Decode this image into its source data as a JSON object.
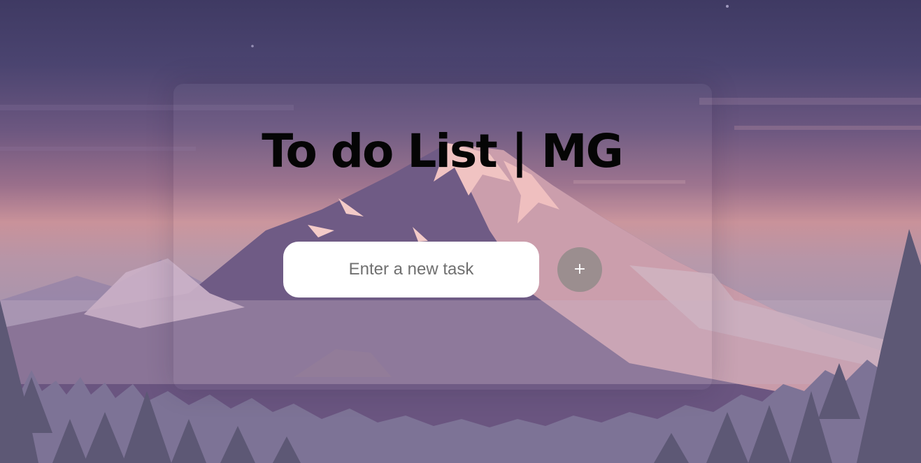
{
  "app": {
    "title": "To do List | MG"
  },
  "task_form": {
    "input_value": "",
    "input_placeholder": "Enter a new task",
    "add_button_label": "+"
  },
  "background": {
    "image": "mountain-landscape",
    "colors": {
      "sky_top": "#3f3a63",
      "sky_glow": "#c9929a",
      "mountain": "#5c4c72",
      "snow": "#e9b8b8",
      "trees": "#5b5672"
    }
  },
  "colors": {
    "title": "#050505",
    "input_bg": "#ffffff",
    "add_button_bg": "#9b8e8f",
    "add_button_fg": "#ffffff"
  }
}
